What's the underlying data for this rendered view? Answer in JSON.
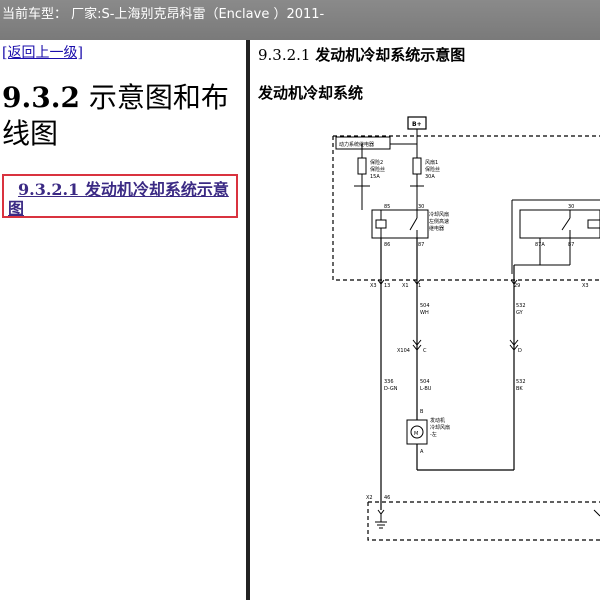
{
  "topbar": {
    "title": "当前车型： 厂家:S-上海别克昂科雷（Enclave ）2011-"
  },
  "left": {
    "back_link": "[返回上一级]",
    "section_number": "9.3.2",
    "section_title": "示意图和布线图",
    "toc_link": "9.3.2.1 发动机冷却系统示意图"
  },
  "right": {
    "sub_number": "9.3.2.1",
    "sub_title": "发动机冷却系统示意图",
    "heading": "发动机冷却系统"
  },
  "diagram": {
    "b_plus": "B+",
    "relay_box": "动力系统继电器",
    "fuse2_line1": "保险2",
    "fuse2_line2": "保险丝",
    "fuse2_amp": "15A",
    "fuse1_line1": "风扇1",
    "fuse1_line2": "保险丝",
    "fuse1_amp": "30A",
    "pin85": "85",
    "pin30a": "30",
    "pin86": "86",
    "pin87": "87",
    "relay_l1": "冷却风扇",
    "relay_l2": "左侧高速",
    "relay_l3": "继电器",
    "pin30b": "30",
    "pin87a": "87A",
    "pin87b": "87",
    "x3": "X3",
    "x3_13": "13",
    "x1": "X1",
    "x1_1": "1",
    "x1_29": "29",
    "x3b": "X3",
    "w504": "504",
    "wwh": "WH",
    "w532": "532",
    "wgy": "GY",
    "x104": "X104",
    "x104c": "C",
    "x104d": "D",
    "w336": "336",
    "wdgn": "D-GN",
    "w504b": "504",
    "wlbu": "L-BU",
    "w532b": "532",
    "wbk": "BK",
    "motor_b": "B",
    "motor_l1": "发动机",
    "motor_l2": "冷却风扇",
    "motor_l3": "-左",
    "motor_a": "A",
    "motor_m": "M",
    "x2": "X2",
    "x2_46": "46"
  }
}
